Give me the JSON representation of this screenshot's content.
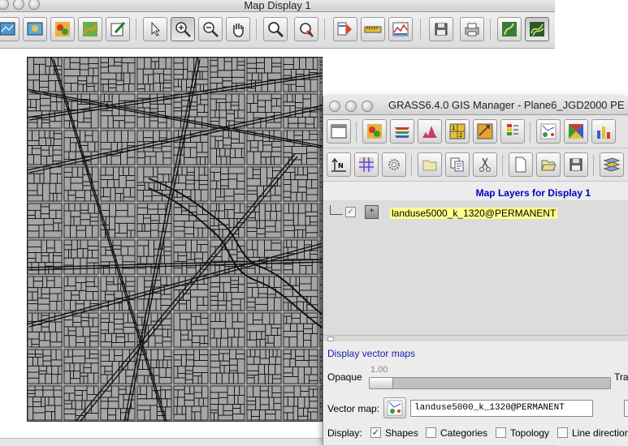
{
  "map_display": {
    "title": "Map Display 1",
    "toolbar": [
      {
        "icon": "display-map-icon",
        "label": ""
      },
      {
        "icon": "render-map-icon",
        "label": ""
      },
      {
        "icon": "overlay-icon",
        "label": ""
      },
      {
        "icon": "erase-icon",
        "label": ""
      },
      {
        "icon": "draw-icon",
        "label": ""
      },
      {
        "icon": "pointer-icon",
        "label": ""
      },
      {
        "icon": "zoom-in-icon",
        "label": ""
      },
      {
        "icon": "zoom-out-icon",
        "label": ""
      },
      {
        "icon": "pan-hand-icon",
        "label": ""
      },
      {
        "icon": "zoom-menu-icon",
        "label": ""
      },
      {
        "icon": "query-icon",
        "label": ""
      },
      {
        "icon": "analyze-icon",
        "label": ""
      },
      {
        "icon": "measure-icon",
        "label": ""
      },
      {
        "icon": "profile-icon",
        "label": ""
      },
      {
        "icon": "save-icon",
        "label": ""
      },
      {
        "icon": "print-icon",
        "label": ""
      },
      {
        "icon": "mode-2d-icon",
        "label": ""
      },
      {
        "icon": "mode-3d-icon",
        "label": ""
      }
    ],
    "active_tool": "zoom-in-icon",
    "map_background": "#a6a6a6",
    "map_lines": "#111111"
  },
  "gis_manager": {
    "title": "GRASS6.4.0 GIS Manager - Plane6_JGD2000 PE",
    "toolbar1": [
      "new-display-icon",
      "raster-icon",
      "layers-icon",
      "histogram-icon",
      "grid-icon",
      "arrow-grid-icon",
      "legend-icon",
      "vector-icon",
      "triangle-icon",
      "bar-chart-icon"
    ],
    "toolbar2": [
      "north-arrow-icon",
      "grid-overlay-icon",
      "gear-icon",
      "folder-icon",
      "copy-icon",
      "cut-icon",
      "new-file-icon",
      "open-icon",
      "save-icon",
      "layers-icon"
    ],
    "layers_header": "Map Layers for Display 1",
    "layers": [
      {
        "name": "landuse5000_k_1320@PERMANENT",
        "checked": true,
        "box_label": "+"
      }
    ],
    "properties": {
      "title": "Display vector maps",
      "opacity_value": "1.00",
      "opacity_label": "Opaque",
      "opacity_right_label": "Tra",
      "opacity_level": 1.0,
      "vector_map_label": "Vector map:",
      "vector_map_value": "landuse5000_k_1320@PERMANENT",
      "display_label": "Display:",
      "display_options": [
        {
          "label": "Shapes",
          "checked": true
        },
        {
          "label": "Categories",
          "checked": false
        },
        {
          "label": "Topology",
          "checked": false
        },
        {
          "label": "Line direction",
          "checked": false
        }
      ]
    }
  }
}
